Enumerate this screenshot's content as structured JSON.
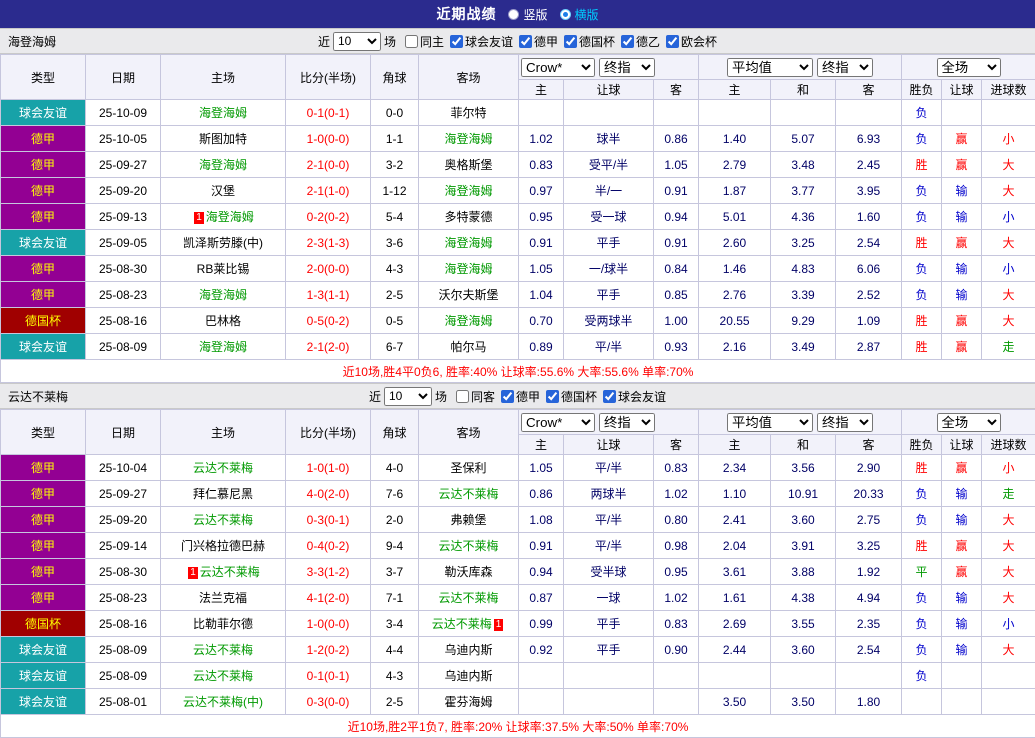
{
  "topbar": {
    "title": "近期战绩",
    "options": [
      {
        "label": "竖版",
        "selected": false
      },
      {
        "label": "横版",
        "selected": true
      }
    ]
  },
  "colors": {
    "topbar_bg": "#2b2b8e",
    "friendly_badge": "#17a2a8",
    "league_badge": "#930093",
    "cup_badge": "#a00000",
    "focus_team": "#009900",
    "score": "#ff0000",
    "win": "#ff0000",
    "loss": "#0000cc",
    "draw": "#009900"
  },
  "table_header": {
    "type": "类型",
    "date": "日期",
    "home": "主场",
    "score": "比分(半场)",
    "corner": "角球",
    "away": "客场",
    "asian_selects": [
      "Crow*",
      "终指"
    ],
    "euro_selects": [
      "平均值",
      "终指"
    ],
    "result_select": "全场",
    "sub_headers": [
      "主",
      "让球",
      "客",
      "主",
      "和",
      "客",
      "胜负",
      "让球",
      "进球数"
    ]
  },
  "sections": [
    {
      "team": "海登海姆",
      "filters": {
        "prefix": "近",
        "count": "10",
        "suffix": "场",
        "checkboxes": [
          {
            "label": "同主",
            "checked": false
          },
          {
            "label": "球会友谊",
            "checked": true
          },
          {
            "label": "德甲",
            "checked": true
          },
          {
            "label": "德国杯",
            "checked": true
          },
          {
            "label": "德乙",
            "checked": true
          },
          {
            "label": "欧会杯",
            "checked": true
          }
        ]
      },
      "rows": [
        {
          "league": "球会友谊",
          "lt": "friendly",
          "date": "25-10-09",
          "home": {
            "name": "海登海姆",
            "focus": true
          },
          "score": "0-1(0-1)",
          "corner": "0-0",
          "away": {
            "name": "菲尔特",
            "focus": false
          },
          "asian": [
            "",
            "",
            ""
          ],
          "euro": [
            "",
            "",
            ""
          ],
          "res": [
            [
              "负",
              "b"
            ],
            [
              "",
              ""
            ],
            [
              "",
              ""
            ]
          ]
        },
        {
          "league": "德甲",
          "lt": "league",
          "date": "25-10-05",
          "home": {
            "name": "斯图加特",
            "focus": false
          },
          "score": "1-0(0-0)",
          "corner": "1-1",
          "away": {
            "name": "海登海姆",
            "focus": true
          },
          "asian": [
            "1.02",
            "球半",
            "0.86"
          ],
          "euro": [
            "1.40",
            "5.07",
            "6.93"
          ],
          "res": [
            [
              "负",
              "b"
            ],
            [
              "赢",
              "r"
            ],
            [
              "小",
              "r"
            ]
          ]
        },
        {
          "league": "德甲",
          "lt": "league",
          "date": "25-09-27",
          "home": {
            "name": "海登海姆",
            "focus": true
          },
          "score": "2-1(0-0)",
          "corner": "3-2",
          "away": {
            "name": "奥格斯堡",
            "focus": false
          },
          "asian": [
            "0.83",
            "受平/半",
            "1.05"
          ],
          "euro": [
            "2.79",
            "3.48",
            "2.45"
          ],
          "res": [
            [
              "胜",
              "r"
            ],
            [
              "赢",
              "r"
            ],
            [
              "大",
              "r"
            ]
          ]
        },
        {
          "league": "德甲",
          "lt": "league",
          "date": "25-09-20",
          "home": {
            "name": "汉堡",
            "focus": false
          },
          "score": "2-1(1-0)",
          "corner": "1-12",
          "away": {
            "name": "海登海姆",
            "focus": true
          },
          "asian": [
            "0.97",
            "半/一",
            "0.91"
          ],
          "euro": [
            "1.87",
            "3.77",
            "3.95"
          ],
          "res": [
            [
              "负",
              "b"
            ],
            [
              "输",
              "b"
            ],
            [
              "大",
              "r"
            ]
          ]
        },
        {
          "league": "德甲",
          "lt": "league",
          "date": "25-09-13",
          "home": {
            "name": "海登海姆",
            "focus": true,
            "card_pre": "1"
          },
          "score": "0-2(0-2)",
          "corner": "5-4",
          "away": {
            "name": "多特蒙德",
            "focus": false
          },
          "asian": [
            "0.95",
            "受一球",
            "0.94"
          ],
          "euro": [
            "5.01",
            "4.36",
            "1.60"
          ],
          "res": [
            [
              "负",
              "b"
            ],
            [
              "输",
              "b"
            ],
            [
              "小",
              "b"
            ]
          ]
        },
        {
          "league": "球会友谊",
          "lt": "friendly",
          "date": "25-09-05",
          "home": {
            "name": "凯泽斯劳滕(中)",
            "focus": false
          },
          "score": "2-3(1-3)",
          "corner": "3-6",
          "away": {
            "name": "海登海姆",
            "focus": true
          },
          "asian": [
            "0.91",
            "平手",
            "0.91"
          ],
          "euro": [
            "2.60",
            "3.25",
            "2.54"
          ],
          "res": [
            [
              "胜",
              "r"
            ],
            [
              "赢",
              "r"
            ],
            [
              "大",
              "r"
            ]
          ]
        },
        {
          "league": "德甲",
          "lt": "league",
          "date": "25-08-30",
          "home": {
            "name": "RB莱比锡",
            "focus": false
          },
          "score": "2-0(0-0)",
          "corner": "4-3",
          "away": {
            "name": "海登海姆",
            "focus": true
          },
          "asian": [
            "1.05",
            "一/球半",
            "0.84"
          ],
          "euro": [
            "1.46",
            "4.83",
            "6.06"
          ],
          "res": [
            [
              "负",
              "b"
            ],
            [
              "输",
              "b"
            ],
            [
              "小",
              "b"
            ]
          ]
        },
        {
          "league": "德甲",
          "lt": "league",
          "date": "25-08-23",
          "home": {
            "name": "海登海姆",
            "focus": true
          },
          "score": "1-3(1-1)",
          "corner": "2-5",
          "away": {
            "name": "沃尔夫斯堡",
            "focus": false
          },
          "asian": [
            "1.04",
            "平手",
            "0.85"
          ],
          "euro": [
            "2.76",
            "3.39",
            "2.52"
          ],
          "res": [
            [
              "负",
              "b"
            ],
            [
              "输",
              "b"
            ],
            [
              "大",
              "r"
            ]
          ]
        },
        {
          "league": "德国杯",
          "lt": "cup",
          "date": "25-08-16",
          "home": {
            "name": "巴林格",
            "focus": false
          },
          "score": "0-5(0-2)",
          "corner": "0-5",
          "away": {
            "name": "海登海姆",
            "focus": true
          },
          "asian": [
            "0.70",
            "受两球半",
            "1.00"
          ],
          "euro": [
            "20.55",
            "9.29",
            "1.09"
          ],
          "res": [
            [
              "胜",
              "r"
            ],
            [
              "赢",
              "r"
            ],
            [
              "大",
              "r"
            ]
          ]
        },
        {
          "league": "球会友谊",
          "lt": "friendly",
          "date": "25-08-09",
          "home": {
            "name": "海登海姆",
            "focus": true
          },
          "score": "2-1(2-0)",
          "corner": "6-7",
          "away": {
            "name": "帕尔马",
            "focus": false
          },
          "asian": [
            "0.89",
            "平/半",
            "0.93"
          ],
          "euro": [
            "2.16",
            "3.49",
            "2.87"
          ],
          "res": [
            [
              "胜",
              "r"
            ],
            [
              "赢",
              "r"
            ],
            [
              "走",
              "g"
            ]
          ]
        }
      ],
      "summary": "近10场,胜4平0负6, 胜率:40% 让球率:55.6% 大率:55.6% 单率:70%"
    },
    {
      "team": "云达不莱梅",
      "filters": {
        "prefix": "近",
        "count": "10",
        "suffix": "场",
        "checkboxes": [
          {
            "label": "同客",
            "checked": false
          },
          {
            "label": "德甲",
            "checked": true
          },
          {
            "label": "德国杯",
            "checked": true
          },
          {
            "label": "球会友谊",
            "checked": true
          }
        ]
      },
      "rows": [
        {
          "league": "德甲",
          "lt": "league",
          "date": "25-10-04",
          "home": {
            "name": "云达不莱梅",
            "focus": true
          },
          "score": "1-0(1-0)",
          "corner": "4-0",
          "away": {
            "name": "圣保利",
            "focus": false
          },
          "asian": [
            "1.05",
            "平/半",
            "0.83"
          ],
          "euro": [
            "2.34",
            "3.56",
            "2.90"
          ],
          "res": [
            [
              "胜",
              "r"
            ],
            [
              "赢",
              "r"
            ],
            [
              "小",
              "r"
            ]
          ]
        },
        {
          "league": "德甲",
          "lt": "league",
          "date": "25-09-27",
          "home": {
            "name": "拜仁慕尼黑",
            "focus": false
          },
          "score": "4-0(2-0)",
          "corner": "7-6",
          "away": {
            "name": "云达不莱梅",
            "focus": true
          },
          "asian": [
            "0.86",
            "两球半",
            "1.02"
          ],
          "euro": [
            "1.10",
            "10.91",
            "20.33"
          ],
          "res": [
            [
              "负",
              "b"
            ],
            [
              "输",
              "b"
            ],
            [
              "走",
              "g"
            ]
          ]
        },
        {
          "league": "德甲",
          "lt": "league",
          "date": "25-09-20",
          "home": {
            "name": "云达不莱梅",
            "focus": true
          },
          "score": "0-3(0-1)",
          "corner": "2-0",
          "away": {
            "name": "弗赖堡",
            "focus": false
          },
          "asian": [
            "1.08",
            "平/半",
            "0.80"
          ],
          "euro": [
            "2.41",
            "3.60",
            "2.75"
          ],
          "res": [
            [
              "负",
              "b"
            ],
            [
              "输",
              "b"
            ],
            [
              "大",
              "r"
            ]
          ]
        },
        {
          "league": "德甲",
          "lt": "league",
          "date": "25-09-14",
          "home": {
            "name": "门兴格拉德巴赫",
            "focus": false
          },
          "score": "0-4(0-2)",
          "corner": "9-4",
          "away": {
            "name": "云达不莱梅",
            "focus": true
          },
          "asian": [
            "0.91",
            "平/半",
            "0.98"
          ],
          "euro": [
            "2.04",
            "3.91",
            "3.25"
          ],
          "res": [
            [
              "胜",
              "r"
            ],
            [
              "赢",
              "r"
            ],
            [
              "大",
              "r"
            ]
          ]
        },
        {
          "league": "德甲",
          "lt": "league",
          "date": "25-08-30",
          "home": {
            "name": "云达不莱梅",
            "focus": true,
            "card_pre": "1"
          },
          "score": "3-3(1-2)",
          "corner": "3-7",
          "away": {
            "name": "勒沃库森",
            "focus": false
          },
          "asian": [
            "0.94",
            "受半球",
            "0.95"
          ],
          "euro": [
            "3.61",
            "3.88",
            "1.92"
          ],
          "res": [
            [
              "平",
              "g"
            ],
            [
              "赢",
              "r"
            ],
            [
              "大",
              "r"
            ]
          ]
        },
        {
          "league": "德甲",
          "lt": "league",
          "date": "25-08-23",
          "home": {
            "name": "法兰克福",
            "focus": false
          },
          "score": "4-1(2-0)",
          "corner": "7-1",
          "away": {
            "name": "云达不莱梅",
            "focus": true
          },
          "asian": [
            "0.87",
            "一球",
            "1.02"
          ],
          "euro": [
            "1.61",
            "4.38",
            "4.94"
          ],
          "res": [
            [
              "负",
              "b"
            ],
            [
              "输",
              "b"
            ],
            [
              "大",
              "r"
            ]
          ]
        },
        {
          "league": "德国杯",
          "lt": "cup",
          "date": "25-08-16",
          "home": {
            "name": "比勒菲尔德",
            "focus": false
          },
          "score": "1-0(0-0)",
          "corner": "3-4",
          "away": {
            "name": "云达不莱梅",
            "focus": true,
            "card_post": "1"
          },
          "asian": [
            "0.99",
            "平手",
            "0.83"
          ],
          "euro": [
            "2.69",
            "3.55",
            "2.35"
          ],
          "res": [
            [
              "负",
              "b"
            ],
            [
              "输",
              "b"
            ],
            [
              "小",
              "b"
            ]
          ]
        },
        {
          "league": "球会友谊",
          "lt": "friendly",
          "date": "25-08-09",
          "home": {
            "name": "云达不莱梅",
            "focus": true
          },
          "score": "1-2(0-2)",
          "corner": "4-4",
          "away": {
            "name": "乌迪内斯",
            "focus": false
          },
          "asian": [
            "0.92",
            "平手",
            "0.90"
          ],
          "euro": [
            "2.44",
            "3.60",
            "2.54"
          ],
          "res": [
            [
              "负",
              "b"
            ],
            [
              "输",
              "b"
            ],
            [
              "大",
              "r"
            ]
          ]
        },
        {
          "league": "球会友谊",
          "lt": "friendly",
          "date": "25-08-09",
          "home": {
            "name": "云达不莱梅",
            "focus": true
          },
          "score": "0-1(0-1)",
          "corner": "4-3",
          "away": {
            "name": "乌迪内斯",
            "focus": false
          },
          "asian": [
            "",
            "",
            ""
          ],
          "euro": [
            "",
            "",
            ""
          ],
          "res": [
            [
              "负",
              "b"
            ],
            [
              "",
              ""
            ],
            [
              "",
              ""
            ]
          ]
        },
        {
          "league": "球会友谊",
          "lt": "friendly",
          "date": "25-08-01",
          "home": {
            "name": "云达不莱梅(中)",
            "focus": true
          },
          "score": "0-3(0-0)",
          "corner": "2-5",
          "away": {
            "name": "霍芬海姆",
            "focus": false
          },
          "asian": [
            "",
            "",
            ""
          ],
          "euro": [
            "3.50",
            "3.50",
            "1.80"
          ],
          "res": [
            [
              "",
              ""
            ],
            [
              "",
              ""
            ],
            [
              "",
              ""
            ]
          ]
        }
      ],
      "summary": "近10场,胜2平1负7, 胜率:20% 让球率:37.5% 大率:50% 单率:70%"
    }
  ]
}
